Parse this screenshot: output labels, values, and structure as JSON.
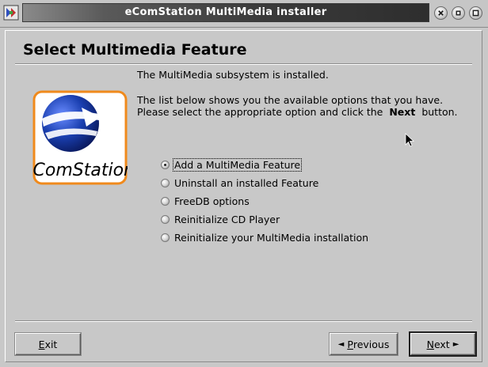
{
  "window": {
    "title": "eComStation MultiMedia installer",
    "buttons": {
      "close_icon": "close-icon",
      "minimize_icon": "minimize-icon",
      "maximize_icon": "maximize-icon"
    }
  },
  "page": {
    "heading": "Select Multimedia Feature",
    "logo_text": "eComStation",
    "info_line1": "The MultiMedia subsystem is installed.",
    "info_line2": "The list below shows you the available options that you have.",
    "info_line3_prefix": "Please select the appropriate option and click the",
    "info_line3_bold": "Next",
    "info_line3_suffix": "button."
  },
  "options": [
    {
      "label": "Add a MultiMedia Feature",
      "selected": true
    },
    {
      "label": "Uninstall an installed Feature",
      "selected": false
    },
    {
      "label": "FreeDB options",
      "selected": false
    },
    {
      "label": "Reinitialize CD Player",
      "selected": false
    },
    {
      "label": "Reinitialize your MultiMedia installation",
      "selected": false
    }
  ],
  "footer": {
    "exit_mnemonic": "E",
    "exit_rest": "xit",
    "previous_arrow": "◄",
    "previous_mnemonic": "P",
    "previous_rest": "revious",
    "next_mnemonic": "N",
    "next_rest": "ext",
    "next_arrow": "►"
  },
  "colors": {
    "background": "#c8c8c8",
    "titlebar_dark": "#2e2e2e",
    "logo_orange": "#f08a1c",
    "logo_blue": "#1a3fb0"
  }
}
